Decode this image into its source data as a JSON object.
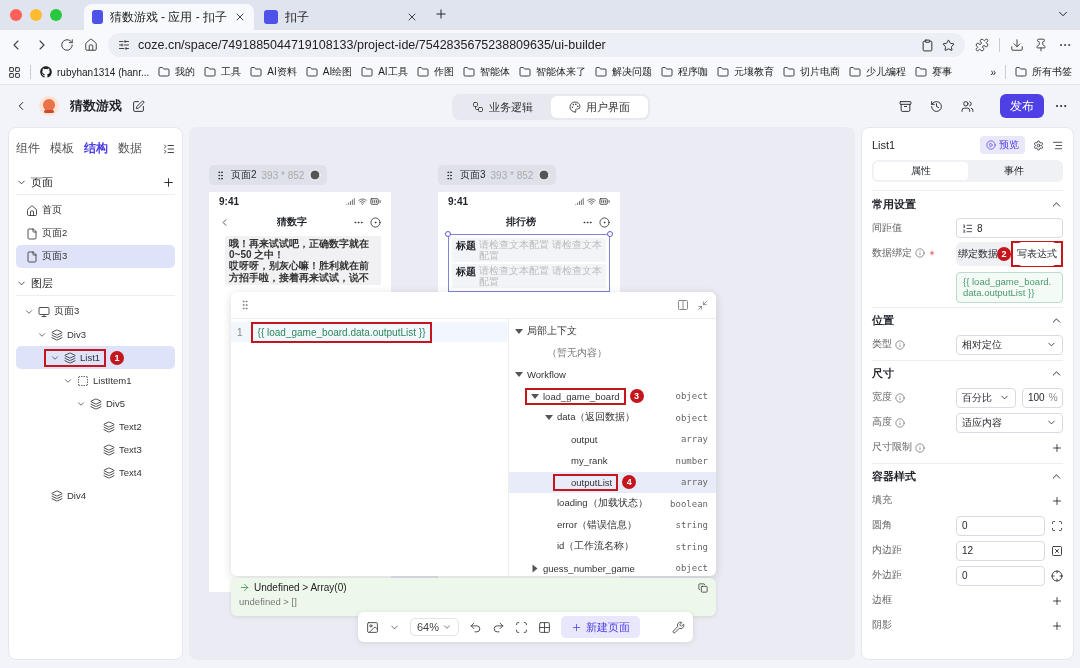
{
  "browser": {
    "tabs": [
      {
        "title": "猜数游戏 - 应用 - 扣子",
        "selected": true
      },
      {
        "title": "扣子",
        "selected": false
      }
    ],
    "url": "coze.cn/space/7491885044719108133/project-ide/7542835675238809635/ui-builder",
    "bookmarks": [
      {
        "label": "rubyhan1314 (hanr...",
        "kind": "github"
      },
      {
        "label": "我的",
        "kind": "folder"
      },
      {
        "label": "工具",
        "kind": "folder"
      },
      {
        "label": "AI资料",
        "kind": "folder"
      },
      {
        "label": "AI绘图",
        "kind": "folder"
      },
      {
        "label": "AI工具",
        "kind": "folder"
      },
      {
        "label": "作图",
        "kind": "folder"
      },
      {
        "label": "智能体",
        "kind": "folder"
      },
      {
        "label": "智能体来了",
        "kind": "folder"
      },
      {
        "label": "解决问题",
        "kind": "folder"
      },
      {
        "label": "程序咖",
        "kind": "folder"
      },
      {
        "label": "元壤教育",
        "kind": "folder"
      },
      {
        "label": "切片电商",
        "kind": "folder"
      },
      {
        "label": "少儿编程",
        "kind": "folder"
      },
      {
        "label": "赛事",
        "kind": "folder"
      }
    ],
    "bookmarks_more": "»",
    "all_bookmarks": "所有书签"
  },
  "header": {
    "title": "猜数游戏",
    "modes": [
      {
        "label": "业务逻辑",
        "kind": "logic",
        "selected": false
      },
      {
        "label": "用户界面",
        "kind": "ui",
        "selected": true
      }
    ],
    "publish": "发布"
  },
  "left_panel": {
    "tabs": [
      {
        "label": "组件",
        "selected": false
      },
      {
        "label": "模板",
        "selected": false
      },
      {
        "label": "结构",
        "selected": true
      },
      {
        "label": "数据",
        "selected": false
      }
    ],
    "pages_title": "页面",
    "pages": [
      {
        "label": "首页",
        "kind": "home",
        "selected": false
      },
      {
        "label": "页面2",
        "kind": "page",
        "selected": false
      },
      {
        "label": "页面3",
        "kind": "page",
        "selected": true
      }
    ],
    "layers_title": "图层",
    "layers": [
      {
        "label": "页面3",
        "kind": "screen",
        "expanded": true,
        "selected": false,
        "children": [
          {
            "label": "Div3",
            "kind": "layer",
            "expanded": true,
            "selected": false,
            "children": [
              {
                "label": "List1",
                "kind": "layer",
                "expanded": true,
                "selected": true,
                "callout": "1",
                "children": [
                  {
                    "label": "ListItem1",
                    "kind": "item",
                    "expanded": true,
                    "selected": false,
                    "children": [
                      {
                        "label": "Div5",
                        "kind": "layer",
                        "expanded": true,
                        "selected": false,
                        "children": [
                          {
                            "label": "Text2",
                            "kind": "layer",
                            "selected": false
                          },
                          {
                            "label": "Text3",
                            "kind": "layer",
                            "selected": false
                          },
                          {
                            "label": "Text4",
                            "kind": "layer",
                            "selected": false
                          }
                        ]
                      }
                    ]
                  }
                ]
              }
            ]
          },
          {
            "label": "Div4",
            "kind": "layer",
            "selected": false
          }
        ]
      }
    ]
  },
  "artboards": [
    {
      "name": "页面2",
      "size": "393 * 852",
      "time": "9:41",
      "title": "猜数字",
      "kind": "chat",
      "messages": [
        "哦！再来试试吧，正确数字就在0~50 之中！",
        "哎呀呀，别灰心嘛！胜利就在前方招手啦，接着再来试试，说不"
      ]
    },
    {
      "name": "页面3",
      "size": "393 * 852",
      "time": "9:41",
      "title": "排行榜",
      "kind": "list",
      "rows": [
        {
          "label": "标题",
          "text": "请检查文本配置 请检查文本配置"
        },
        {
          "label": "标题",
          "text": "请检查文本配置 请检查文本配置"
        }
      ]
    }
  ],
  "editor": {
    "line_number": "1",
    "code": "{{ load_game_board.data.outputList }}",
    "code_boxed": true,
    "context": [
      {
        "label": "局部上下文",
        "expanded": true,
        "children": [
          {
            "label": "（暂无内容）",
            "kind": "empty"
          }
        ]
      },
      {
        "label": "Workflow",
        "expanded": true,
        "children": [
          {
            "label": "load_game_board",
            "type": "object",
            "expanded": true,
            "selected": false,
            "callout": "3",
            "children": [
              {
                "label": "data（返回数据）",
                "type": "object",
                "expanded": true,
                "selected": false,
                "children": [
                  {
                    "label": "output",
                    "type": "array",
                    "selected": false
                  },
                  {
                    "label": "my_rank",
                    "type": "number",
                    "selected": false
                  },
                  {
                    "label": "outputList",
                    "type": "array",
                    "selected": true,
                    "callout": "4"
                  }
                ]
              },
              {
                "label": "loading（加载状态）",
                "type": "boolean",
                "selected": false
              },
              {
                "label": "error（错误信息）",
                "type": "string",
                "selected": false
              },
              {
                "label": "id（工作流名称）",
                "type": "string",
                "selected": false
              }
            ]
          },
          {
            "label": "guess_number_game",
            "type": "object",
            "expanded": false,
            "selected": false
          }
        ]
      }
    ],
    "result": {
      "title": "Undefined > Array(0)",
      "detail": "undefined > []"
    }
  },
  "toolbar": {
    "zoom": "64%",
    "new_page": "新建页面"
  },
  "right_panel": {
    "title": "List1",
    "preview": "预览",
    "tabs": [
      {
        "label": "属性",
        "selected": true
      },
      {
        "label": "事件",
        "selected": false
      }
    ],
    "sections": [
      {
        "title": "常用设置",
        "expanded": true,
        "rows": [
          {
            "kind": "spacing",
            "label": "间距值",
            "value": "8"
          },
          {
            "kind": "binding",
            "label": "数据绑定",
            "info": true,
            "required": true,
            "options": [
              {
                "label": "绑定数据",
                "selected": false
              },
              {
                "label": "写表达式",
                "selected": true,
                "callout": "2"
              }
            ],
            "expression": "{{ load_game_board.data.outputList }}"
          }
        ]
      },
      {
        "title": "位置",
        "expanded": true,
        "rows": [
          {
            "kind": "select",
            "label": "类型",
            "info": true,
            "value": "相对定位"
          }
        ]
      },
      {
        "title": "尺寸",
        "expanded": true,
        "rows": [
          {
            "kind": "size",
            "label": "宽度",
            "info": true,
            "value": "百分比",
            "amount": "100",
            "unit": "%"
          },
          {
            "kind": "select",
            "label": "高度",
            "info": true,
            "value": "适应内容"
          },
          {
            "kind": "plus",
            "label": "尺寸限制",
            "info": true
          }
        ]
      },
      {
        "title": "容器样式",
        "expanded": true,
        "rows": [
          {
            "kind": "plus",
            "label": "填充"
          },
          {
            "kind": "corner",
            "label": "圆角",
            "value": "0"
          },
          {
            "kind": "padding",
            "label": "内边距",
            "value": "12"
          },
          {
            "kind": "margin",
            "label": "外边距",
            "value": "0"
          },
          {
            "kind": "plus",
            "label": "边框"
          },
          {
            "kind": "plus",
            "label": "阴影"
          }
        ]
      }
    ]
  }
}
